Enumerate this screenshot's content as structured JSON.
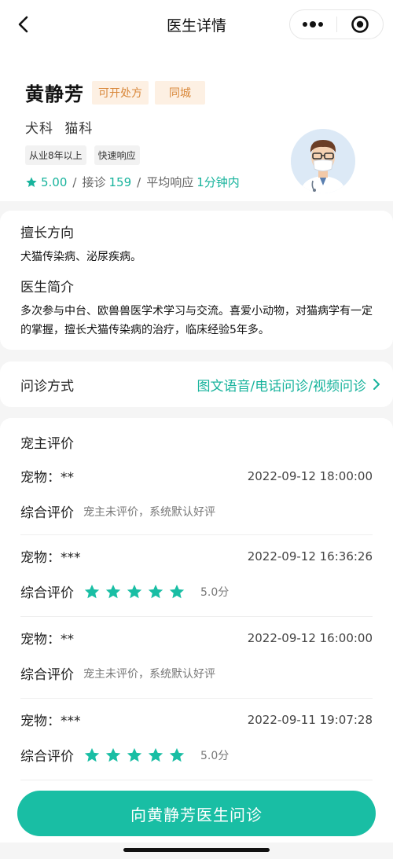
{
  "nav": {
    "title": "医生详情",
    "back_icon": "chevron-left-icon",
    "more_icon": "more-dots-icon",
    "close_icon": "target-close-icon"
  },
  "doctor": {
    "name": "黄静芳",
    "tags": [
      "可开处方",
      "同城"
    ],
    "departments": [
      "犬科",
      "猫科"
    ],
    "badges": [
      "从业8年以上",
      "快速响应"
    ],
    "rating": "5.00",
    "consult_label": "接诊",
    "consult_count": "159",
    "response_label": "平均响应",
    "response_time": "1分钟内",
    "stat_sep": "/"
  },
  "intro": {
    "specialty_title": "擅长方向",
    "specialty_text": "犬猫传染病、泌尿疾病。",
    "bio_title": "医生简介",
    "bio_text": "多次参与中台、欧兽兽医学术学习与交流。喜爱小动物，对猫病学有一定的掌握，擅长犬猫传染病的治疗，临床经验5年多。"
  },
  "consult_method": {
    "label": "问诊方式",
    "value": "图文语音/电话问诊/视频问诊"
  },
  "reviews": {
    "title": "宠主评价",
    "pet_prefix": "宠物：",
    "rating_label": "综合评价",
    "items": [
      {
        "pet": "**",
        "time": "2022-09-12 18:00:00",
        "rated": false,
        "text": "宠主未评价，系统默认好评"
      },
      {
        "pet": "***",
        "time": "2022-09-12 16:36:26",
        "rated": true,
        "stars": 5,
        "score": "5.0分"
      },
      {
        "pet": "**",
        "time": "2022-09-12 16:00:00",
        "rated": false,
        "text": "宠主未评价，系统默认好评"
      },
      {
        "pet": "***",
        "time": "2022-09-11 19:07:28",
        "rated": true,
        "stars": 5,
        "score": "5.0分"
      }
    ]
  },
  "cta": {
    "label": "向黄静芳医生问诊"
  },
  "colors": {
    "accent": "#19bea4",
    "green_text": "#17b39c",
    "tag_orange": "#d9883b",
    "tag_orange_bg": "#fdf0e3"
  }
}
